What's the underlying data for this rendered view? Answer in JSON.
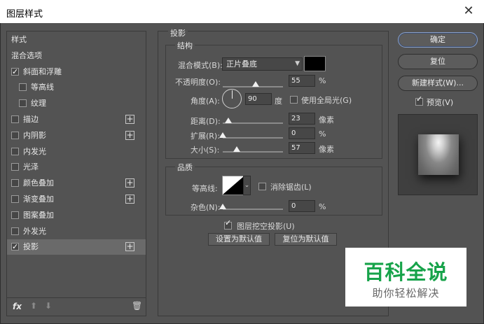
{
  "window": {
    "title": "图层样式",
    "close_glyph": "✕"
  },
  "left_panel": {
    "items": [
      {
        "label": "样式",
        "checkbox": false,
        "checked": false,
        "plus": false,
        "indent": false,
        "selected": false
      },
      {
        "label": "混合选项",
        "checkbox": false,
        "checked": false,
        "plus": false,
        "indent": false,
        "selected": false
      },
      {
        "label": "斜面和浮雕",
        "checkbox": true,
        "checked": true,
        "plus": false,
        "indent": false,
        "selected": false
      },
      {
        "label": "等高线",
        "checkbox": true,
        "checked": false,
        "plus": false,
        "indent": true,
        "selected": false
      },
      {
        "label": "纹理",
        "checkbox": true,
        "checked": false,
        "plus": false,
        "indent": true,
        "selected": false
      },
      {
        "label": "描边",
        "checkbox": true,
        "checked": false,
        "plus": true,
        "indent": false,
        "selected": false
      },
      {
        "label": "内阴影",
        "checkbox": true,
        "checked": false,
        "plus": true,
        "indent": false,
        "selected": false
      },
      {
        "label": "内发光",
        "checkbox": true,
        "checked": false,
        "plus": false,
        "indent": false,
        "selected": false
      },
      {
        "label": "光泽",
        "checkbox": true,
        "checked": false,
        "plus": false,
        "indent": false,
        "selected": false
      },
      {
        "label": "颜色叠加",
        "checkbox": true,
        "checked": false,
        "plus": true,
        "indent": false,
        "selected": false
      },
      {
        "label": "渐变叠加",
        "checkbox": true,
        "checked": false,
        "plus": true,
        "indent": false,
        "selected": false
      },
      {
        "label": "图案叠加",
        "checkbox": true,
        "checked": false,
        "plus": false,
        "indent": false,
        "selected": false
      },
      {
        "label": "外发光",
        "checkbox": true,
        "checked": false,
        "plus": false,
        "indent": false,
        "selected": false
      },
      {
        "label": "投影",
        "checkbox": true,
        "checked": true,
        "plus": true,
        "indent": false,
        "selected": true
      }
    ],
    "plus_glyph": "+",
    "footer": {
      "fx_label": "fx",
      "up_glyph": "⬆",
      "down_glyph": "⬇",
      "trash_glyph": "🗑"
    }
  },
  "drop_shadow": {
    "section_title": "投影",
    "structure": {
      "title": "结构",
      "blend_mode_label": "混合模式(B):",
      "blend_mode_value": "正片叠底",
      "blend_color": "#000000",
      "opacity_label": "不透明度(O):",
      "opacity_value": "55",
      "opacity_unit": "%",
      "opacity_fraction": 0.55,
      "angle_label": "角度(A):",
      "angle_value": "90",
      "angle_unit": "度",
      "global_light_label": "使用全局光(G)",
      "global_light_checked": false,
      "distance_label": "距离(D):",
      "distance_value": "23",
      "distance_unit": "像素",
      "distance_fraction": 0.09,
      "spread_label": "扩展(R):",
      "spread_value": "0",
      "spread_unit": "%",
      "spread_fraction": 0.0,
      "size_label": "大小(S):",
      "size_value": "57",
      "size_unit": "像素",
      "size_fraction": 0.23
    },
    "quality": {
      "title": "品质",
      "contour_label": "等高线:",
      "antialias_label": "消除锯齿(L)",
      "antialias_checked": false,
      "noise_label": "杂色(N):",
      "noise_value": "0",
      "noise_unit": "%",
      "noise_fraction": 0.0
    },
    "knockout_label": "图层挖空投影(U)",
    "knockout_checked": true,
    "set_default_label": "设置为默认值",
    "reset_default_label": "复位为默认值"
  },
  "right_panel": {
    "ok_label": "确定",
    "reset_label": "复位",
    "new_style_label": "新建样式(W)...",
    "preview_label": "预览(V)",
    "preview_checked": true
  },
  "watermark": {
    "title": "百科全说",
    "subtitle": "助你轻松解决"
  }
}
